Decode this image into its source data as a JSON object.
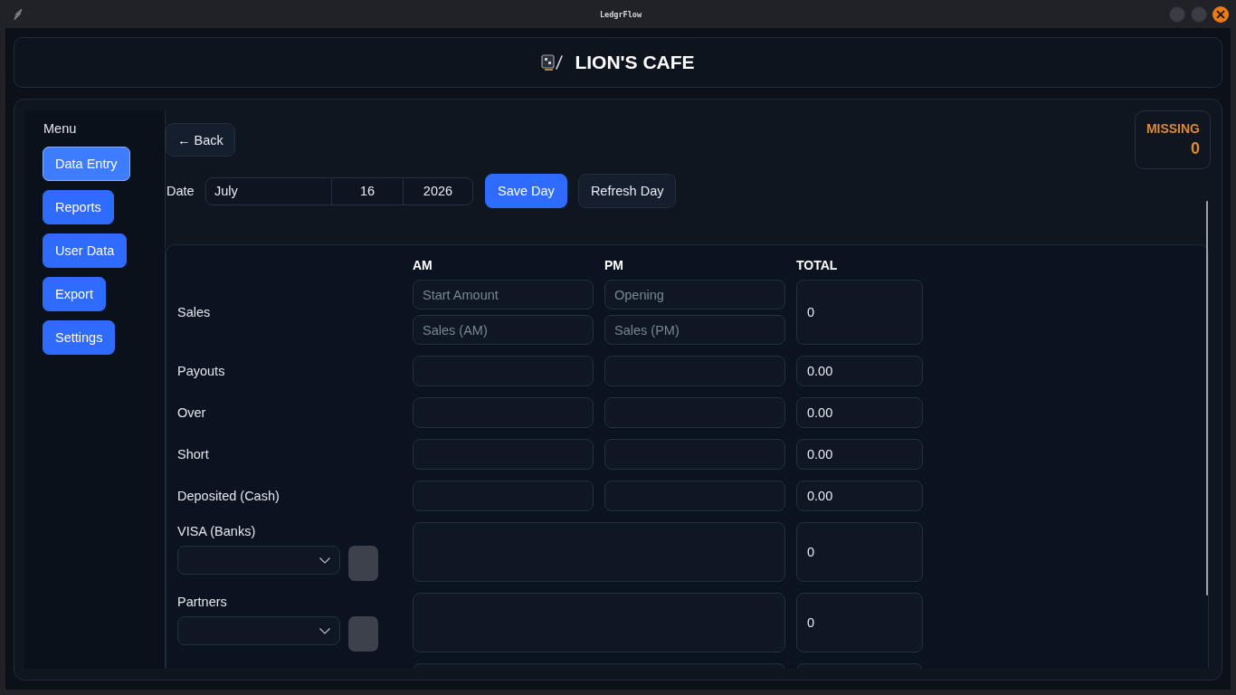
{
  "window": {
    "title": "LedgrFlow"
  },
  "header": {
    "title": "LION'S CAFE"
  },
  "sidebar": {
    "heading": "Menu",
    "items": [
      {
        "label": "Data Entry",
        "selected": true
      },
      {
        "label": "Reports",
        "selected": false
      },
      {
        "label": "User Data",
        "selected": false
      },
      {
        "label": "Export",
        "selected": false
      },
      {
        "label": "Settings",
        "selected": false
      }
    ]
  },
  "toolbar": {
    "back_button": "← Back"
  },
  "missing": {
    "label": "MISSING",
    "count": "0"
  },
  "date": {
    "label": "Date",
    "month": "July",
    "day": "16",
    "year": "2026"
  },
  "actions": [
    {
      "label": "Save Day",
      "kind": "primary"
    },
    {
      "label": "Refresh Day",
      "kind": "secondary"
    }
  ],
  "form": {
    "columns": [
      "AM",
      "PM",
      "TOTAL"
    ],
    "rows": [
      {
        "kind": "split",
        "label": "Sales",
        "am": [
          {
            "placeholder": "Start Amount"
          },
          {
            "placeholder": "Sales (AM)"
          }
        ],
        "pm": [
          {
            "placeholder": "Opening"
          },
          {
            "placeholder": "Sales (PM)"
          }
        ],
        "total": "0"
      },
      {
        "kind": "single",
        "label": "Payouts",
        "total": "0.00"
      },
      {
        "kind": "single",
        "label": "Over",
        "total": "0.00"
      },
      {
        "kind": "single",
        "label": "Short",
        "total": "0.00"
      },
      {
        "kind": "single",
        "label": "Deposited (Cash)",
        "total": "0.00"
      },
      {
        "kind": "picker",
        "label": "VISA (Banks)",
        "total": "0"
      },
      {
        "kind": "picker",
        "label": "Partners",
        "total": "0"
      },
      {
        "kind": "wide"
      }
    ]
  }
}
